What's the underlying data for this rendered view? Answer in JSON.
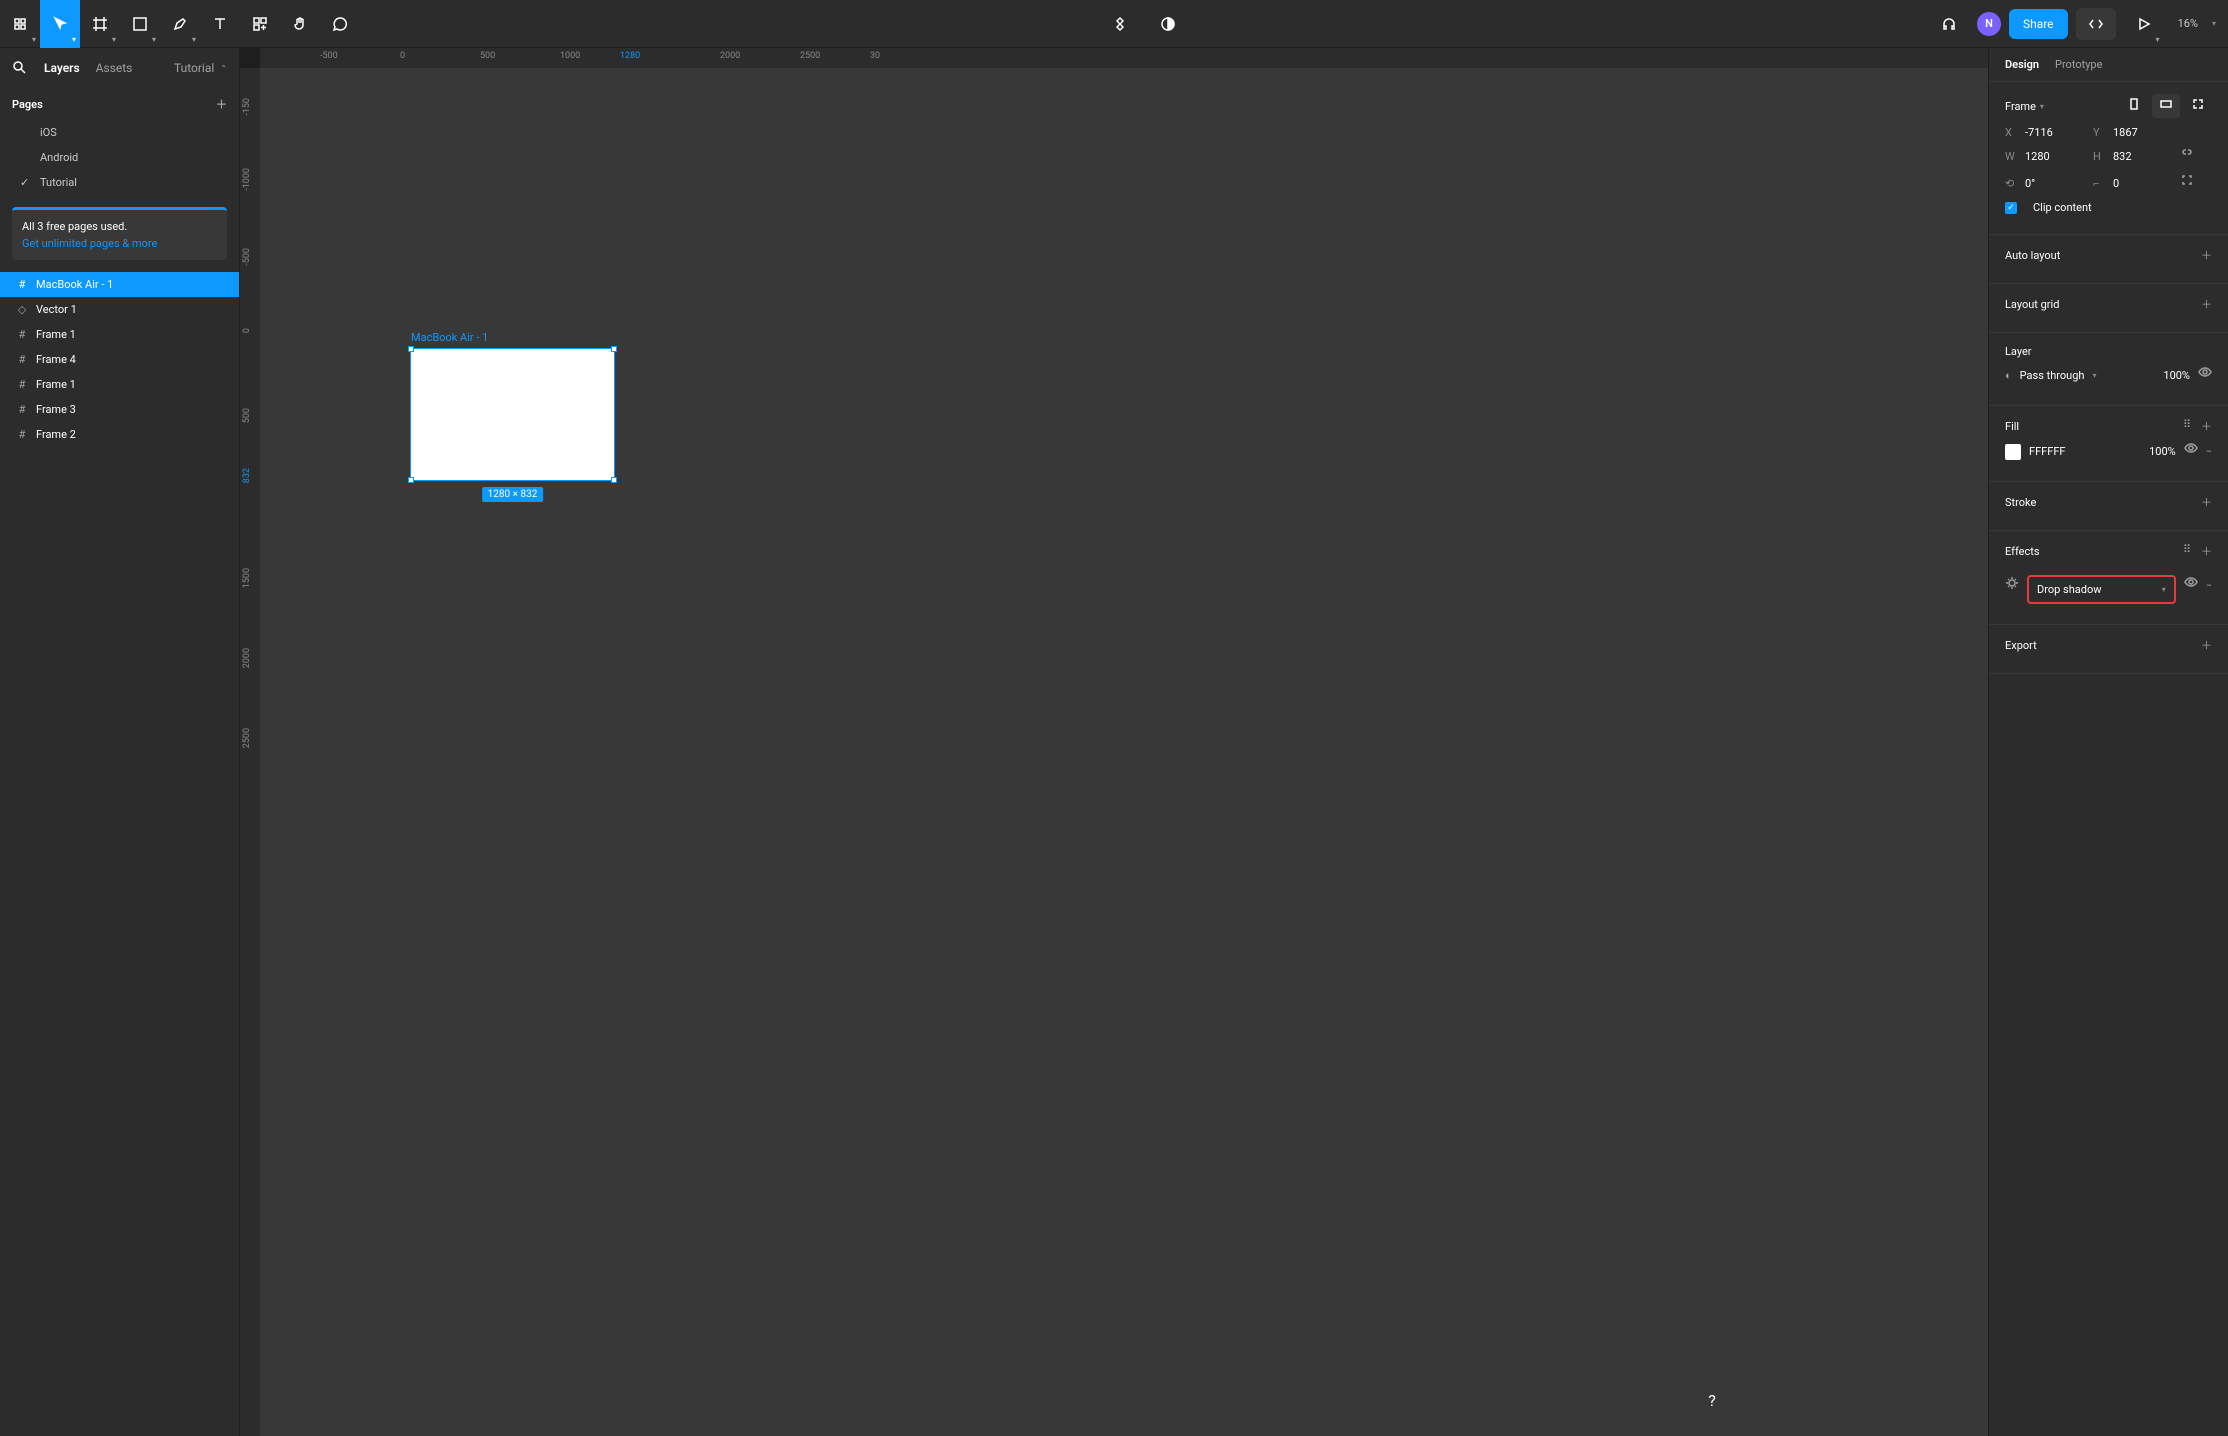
{
  "toolbar": {
    "zoom": "16%",
    "share": "Share"
  },
  "avatar": "N",
  "left": {
    "tabs": {
      "layers": "Layers",
      "assets": "Assets",
      "pageSelector": "Tutorial"
    },
    "pagesHeader": "Pages",
    "pages": [
      "iOS",
      "Android",
      "Tutorial"
    ],
    "upgrade": {
      "line1": "All 3 free pages used.",
      "link": "Get unlimited pages & more"
    },
    "layers": [
      "MacBook Air - 1",
      "Vector 1",
      "Frame 1",
      "Frame 4",
      "Frame 1",
      "Frame 3",
      "Frame 2"
    ]
  },
  "ruler": {
    "h": [
      "-500",
      "0",
      "500",
      "1000",
      "1280",
      "2000",
      "2500",
      "30"
    ],
    "v": [
      "-150",
      "-1000",
      "-500",
      "0",
      "500",
      "832",
      "1500",
      "2000",
      "2500"
    ]
  },
  "canvas": {
    "frameLabel": "MacBook Air - 1",
    "dimensions": "1280 × 832"
  },
  "design": {
    "tabs": {
      "design": "Design",
      "prototype": "Prototype"
    },
    "frameMenu": "Frame",
    "x": "-7116",
    "y": "1867",
    "w": "1280",
    "h": "832",
    "rotation": "0°",
    "radius": "0",
    "clipContent": "Clip content",
    "autoLayout": "Auto layout",
    "layoutGrid": "Layout grid",
    "layer": "Layer",
    "passThrough": "Pass through",
    "layerOpacity": "100%",
    "fill": "Fill",
    "fillHex": "FFFFFF",
    "fillOpacity": "100%",
    "stroke": "Stroke",
    "effects": "Effects",
    "effectType": "Drop shadow",
    "export": "Export"
  }
}
